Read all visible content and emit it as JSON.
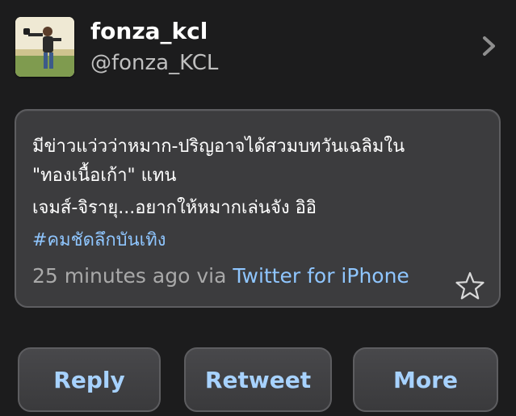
{
  "profile": {
    "display_name": "fonza_kcl",
    "handle": "@fonza_KCL"
  },
  "tweet": {
    "lines": [
      "มีข่าวแว่วว่าหมาก-ปริญอาจได้สวมบทวันเฉลิมใน",
      "\"ทองเนื้อเก้า\" แทน",
      "เจมส์-จิรายุ...อยากให้หมากเล่นจัง อิอิ",
      "#คมชัดลึกบันเทิง"
    ],
    "timestamp": "25 minutes ago",
    "via_label": "via",
    "via_app": "Twitter for iPhone"
  },
  "actions": {
    "reply_label": "Reply",
    "retweet_label": "Retweet",
    "more_label": "More"
  },
  "icons": {
    "chevron": "chevron-right-icon",
    "favorite": "star-outline-icon"
  },
  "colors": {
    "background": "#1c1c1d",
    "card": "#3c3c3e",
    "link": "#8fc6ff",
    "button_text": "#a7d2ff",
    "muted_text": "#a9a9a9"
  }
}
